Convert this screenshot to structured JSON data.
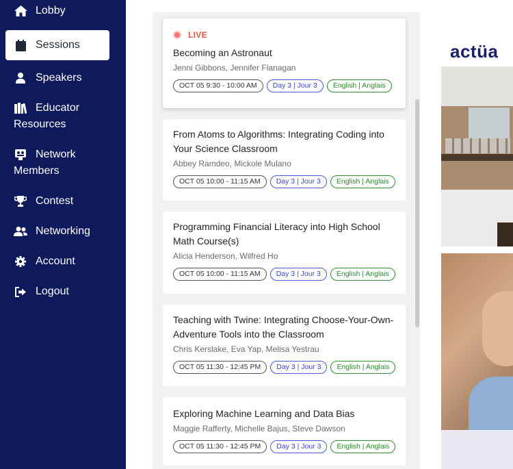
{
  "nav": {
    "items": [
      {
        "label": "Lobby",
        "icon": "home-icon"
      },
      {
        "label": "Sessions",
        "icon": "calendar-check-icon",
        "active": true
      },
      {
        "label": "Speakers",
        "icon": "person-icon"
      },
      {
        "label_line1": "Educator",
        "label_line2": "Resources",
        "icon": "books-icon"
      },
      {
        "label_line1": "Network",
        "label_line2": "Members",
        "icon": "network-icon"
      },
      {
        "label": "Contest",
        "icon": "trophy-icon"
      },
      {
        "label": "Networking",
        "icon": "users-icon"
      },
      {
        "label": "Account",
        "icon": "gear-icon"
      },
      {
        "label": "Logout",
        "icon": "logout-icon"
      }
    ]
  },
  "sessions": {
    "live_label": "LIVE",
    "items": [
      {
        "title": "Becoming an Astronaut",
        "speakers": "Jenni Gibbons, Jennifer Flanagan",
        "time": "OCT 05 9:30 - 10:00 AM",
        "day": "Day 3 | Jour 3",
        "lang": "English | Anglais",
        "live": true
      },
      {
        "title": "From Atoms to Algorithms: Integrating Coding into Your Science Classroom",
        "speakers": "Abbey Ramdeo, Mickole Mulano",
        "time": "OCT 05 10:00 - 11:15 AM",
        "day": "Day 3 | Jour 3",
        "lang": "English | Anglais"
      },
      {
        "title": "Programming Financial Literacy into High School Math Course(s)",
        "speakers": "Alicia Henderson, Wilfred Ho",
        "time": "OCT 05 10:00 - 11:15 AM",
        "day": "Day 3 | Jour 3",
        "lang": "English | Anglais"
      },
      {
        "title": "Teaching with Twine: Integrating Choose-Your-Own-Adventure Tools into the Classroom",
        "speakers": "Chris Kerslake, Eva Yap, Melisa Yestrau",
        "time": "OCT 05 11:30 - 12:45 PM",
        "day": "Day 3 | Jour 3",
        "lang": "English | Anglais"
      },
      {
        "title": "Exploring Machine Learning and Data Bias",
        "speakers": "Maggie Rafferty, Michelle Bajus, Steve Dawson",
        "time": "OCT 05 11:30 - 12:45 PM",
        "day": "Day 3 | Jour 3",
        "lang": "English | Anglais"
      }
    ]
  },
  "brand": {
    "logo_text": "actüa"
  },
  "colors": {
    "sidebar": "#0f1a5c",
    "live": "#e5533d",
    "day_tag": "#3b46d1",
    "lang_tag": "#2a8a2a"
  }
}
